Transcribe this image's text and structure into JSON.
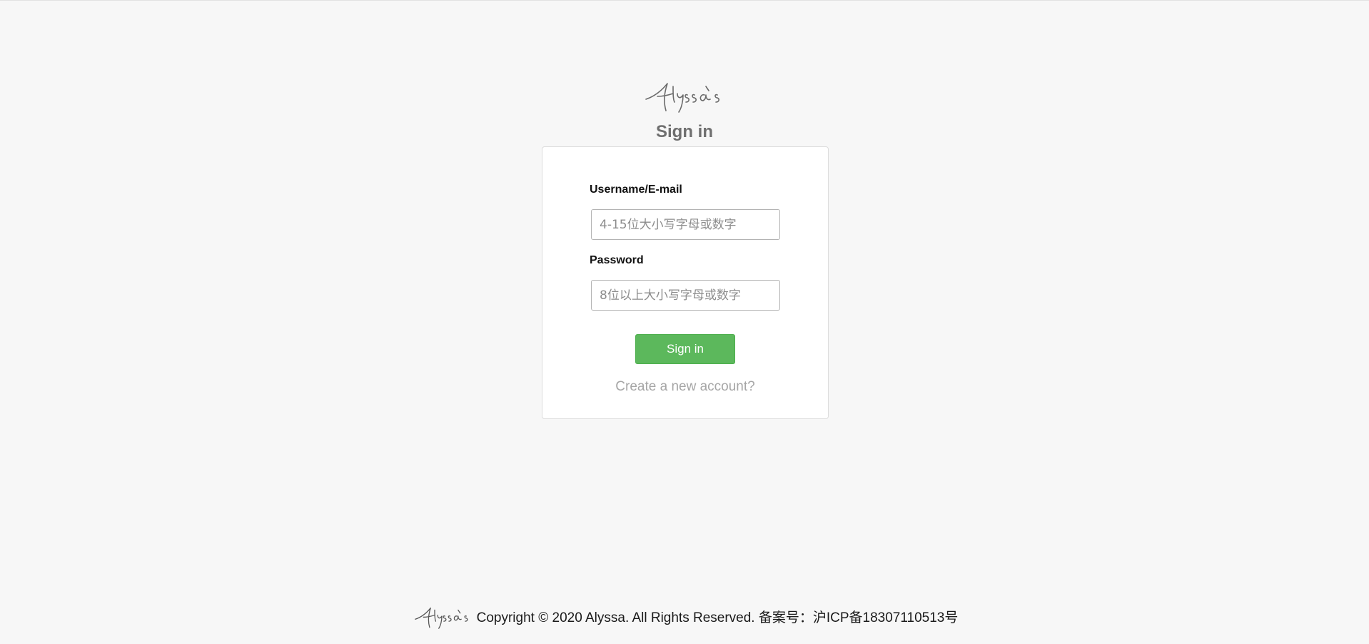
{
  "brand": {
    "logo_text": "Alyssa's"
  },
  "signin": {
    "title": "Sign in",
    "username_label": "Username/E-mail",
    "username_placeholder": "4-15位大小写字母或数字",
    "password_label": "Password",
    "password_placeholder": "8位以上大小写字母或数字",
    "submit_label": "Sign in",
    "create_account_link": "Create a new account?"
  },
  "footer": {
    "text": "Copyright © 2020 Alyssa. All Rights Reserved. 备案号：沪ICP备18307110513号"
  },
  "colors": {
    "background": "#f7f7f7",
    "button": "#5cb85c",
    "link": "#a6a6a6",
    "title": "#6f6f6f"
  }
}
